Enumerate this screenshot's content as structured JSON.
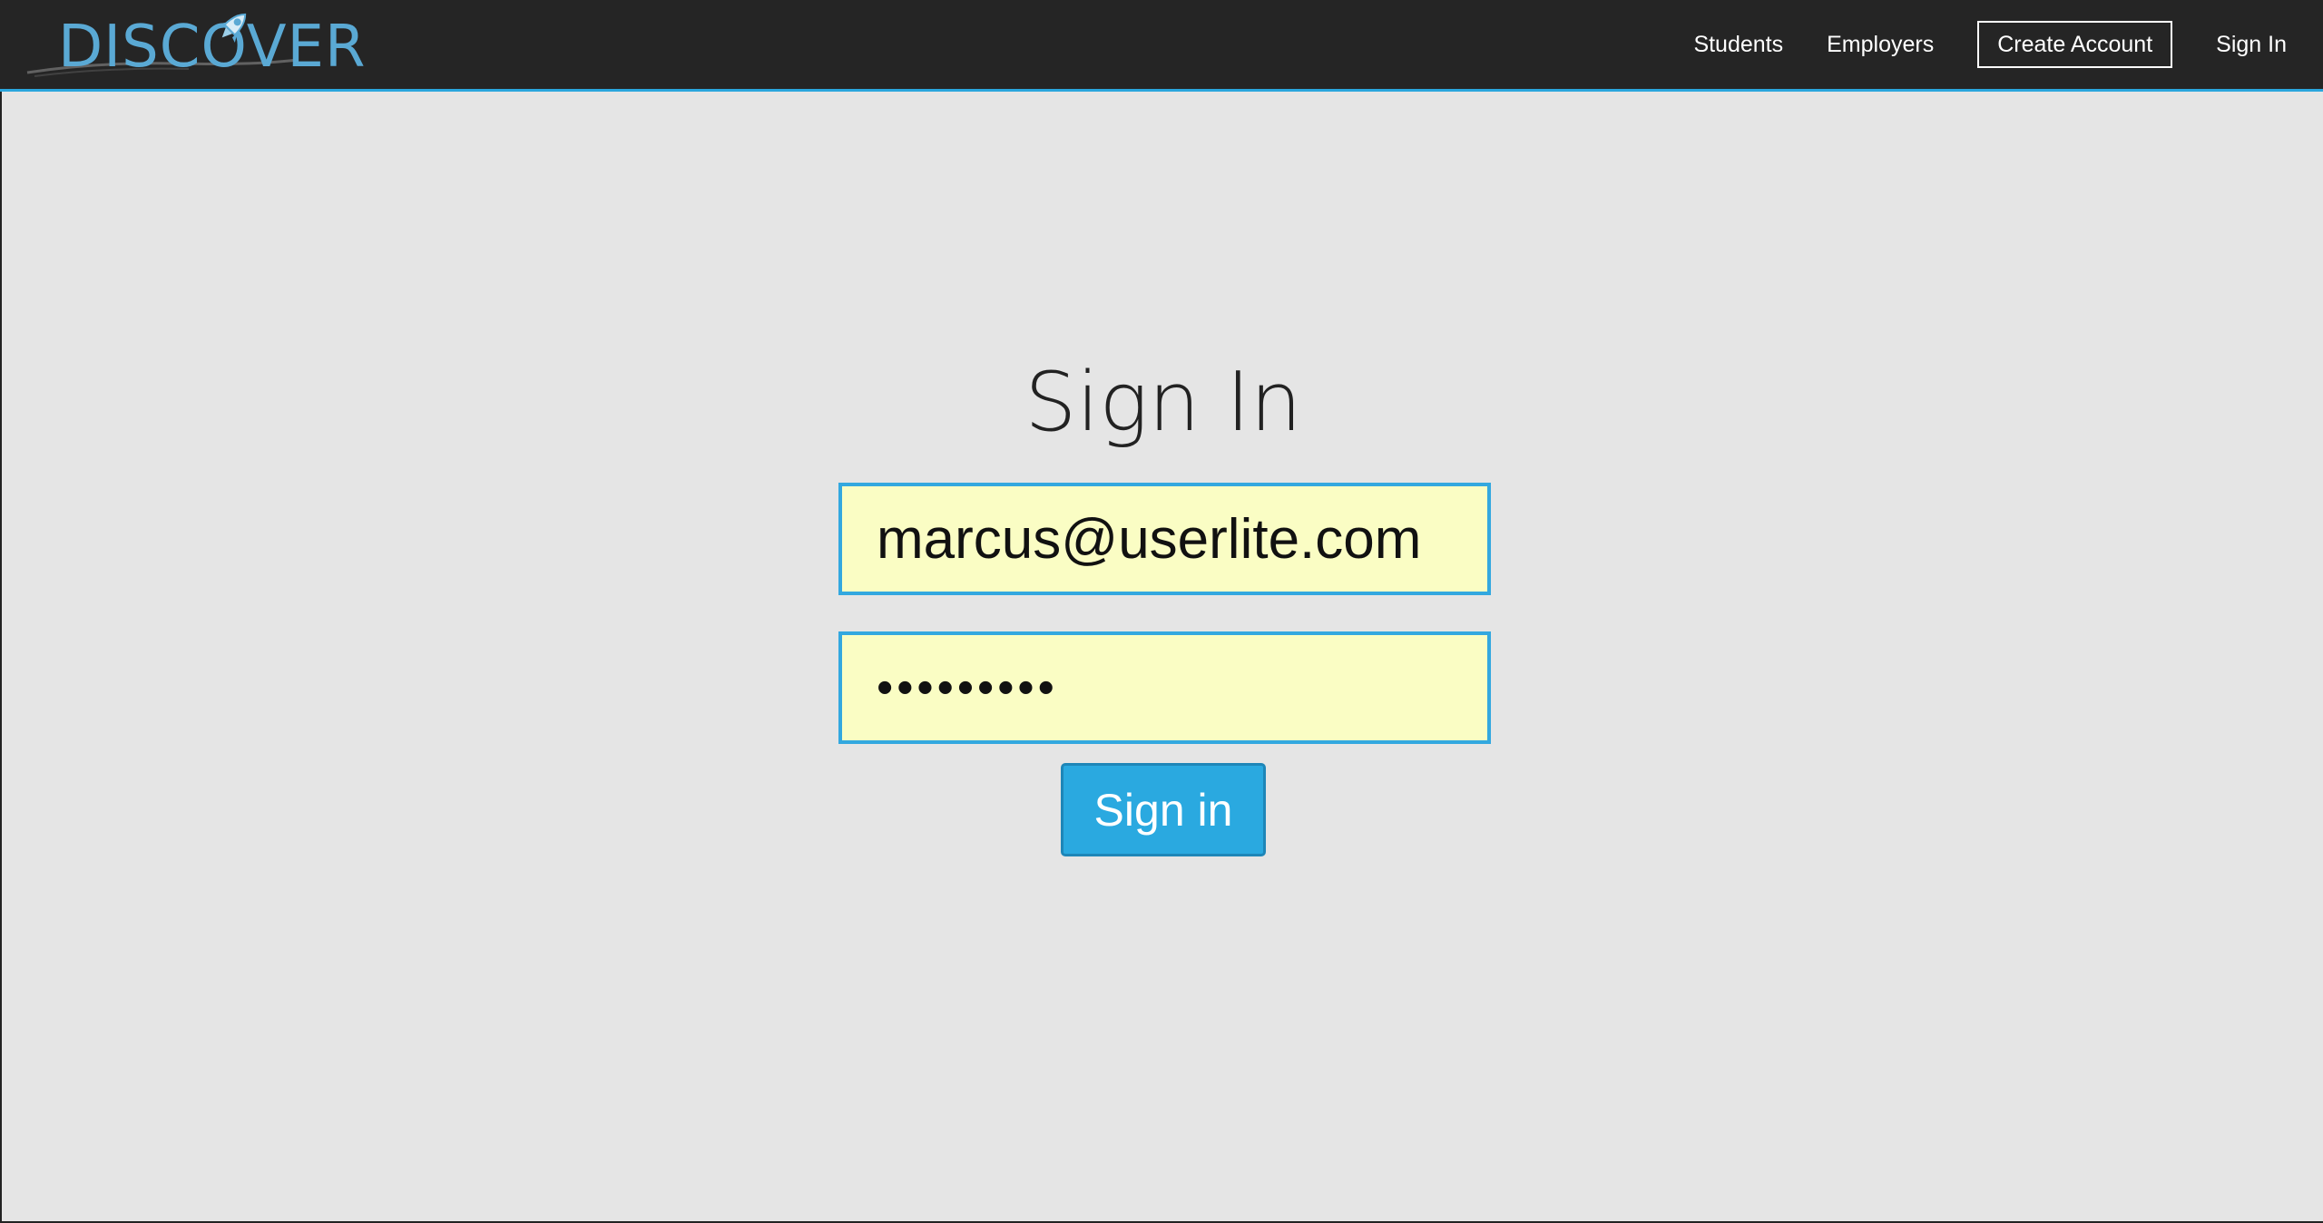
{
  "brand": {
    "logo_text": "DISCOVER",
    "colors": {
      "logo_blue": "#5aa9d4",
      "navbar_bg": "#252525",
      "accent": "#2aa6dd",
      "input_bg": "#fafdc4",
      "button_bg": "#2aa9e0",
      "page_bg": "#e5e5e5"
    },
    "icon": "rocket-icon"
  },
  "nav": {
    "students": "Students",
    "employers": "Employers",
    "create_account": "Create Account",
    "sign_in": "Sign In"
  },
  "form": {
    "title": "Sign In",
    "email_value": "marcus@userlite.com",
    "password_mask": "•••••••••",
    "submit_label": "Sign in"
  }
}
